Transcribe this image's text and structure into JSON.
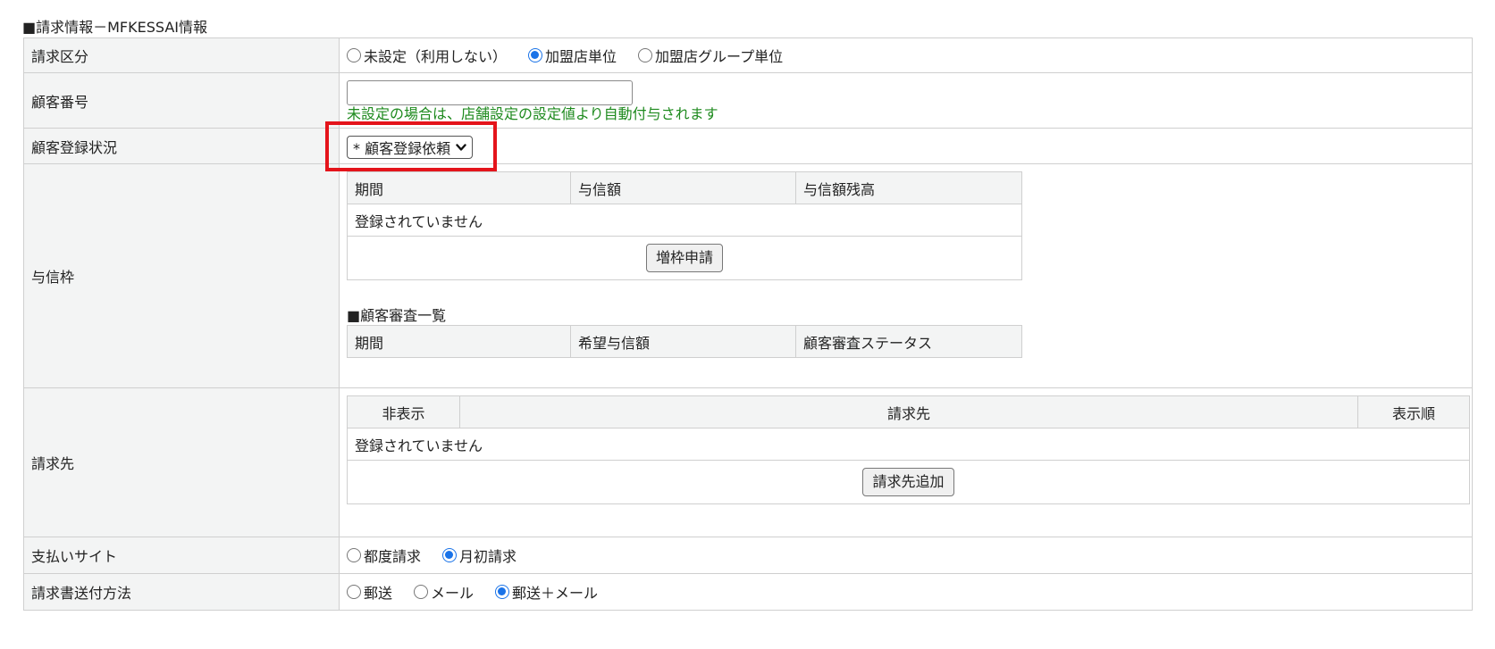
{
  "section_title": "■請求情報－MFKESSAI情報",
  "billing_type": {
    "label": "請求区分",
    "options": [
      {
        "label": "未設定（利用しない）",
        "checked": false
      },
      {
        "label": "加盟店単位",
        "checked": true
      },
      {
        "label": "加盟店グループ単位",
        "checked": false
      }
    ]
  },
  "customer_number": {
    "label": "顧客番号",
    "value": "",
    "hint": "未設定の場合は、店舗設定の設定値より自動付与されます"
  },
  "customer_registration": {
    "label": "顧客登録状況",
    "selected": "* 顧客登録依頼"
  },
  "credit_limit": {
    "label": "与信枠",
    "headers": [
      "期間",
      "与信額",
      "与信額残高"
    ],
    "empty_text": "登録されていません",
    "button_label": "増枠申請",
    "review_title": "■顧客審査一覧",
    "review_headers": [
      "期間",
      "希望与信額",
      "顧客審査ステータス"
    ]
  },
  "billing_destination": {
    "label": "請求先",
    "headers": [
      "非表示",
      "請求先",
      "表示順"
    ],
    "empty_text": "登録されていません",
    "button_label": "請求先追加"
  },
  "payment_site": {
    "label": "支払いサイト",
    "options": [
      {
        "label": "都度請求",
        "checked": false
      },
      {
        "label": "月初請求",
        "checked": true
      }
    ]
  },
  "invoice_delivery": {
    "label": "請求書送付方法",
    "options": [
      {
        "label": "郵送",
        "checked": false
      },
      {
        "label": "メール",
        "checked": false
      },
      {
        "label": "郵送＋メール",
        "checked": true
      }
    ]
  },
  "colors": {
    "accent": "#1a73e8",
    "hint_green": "#1e8a1e",
    "highlight_red": "#e4141b",
    "header_bg": "#f3f4f4"
  }
}
